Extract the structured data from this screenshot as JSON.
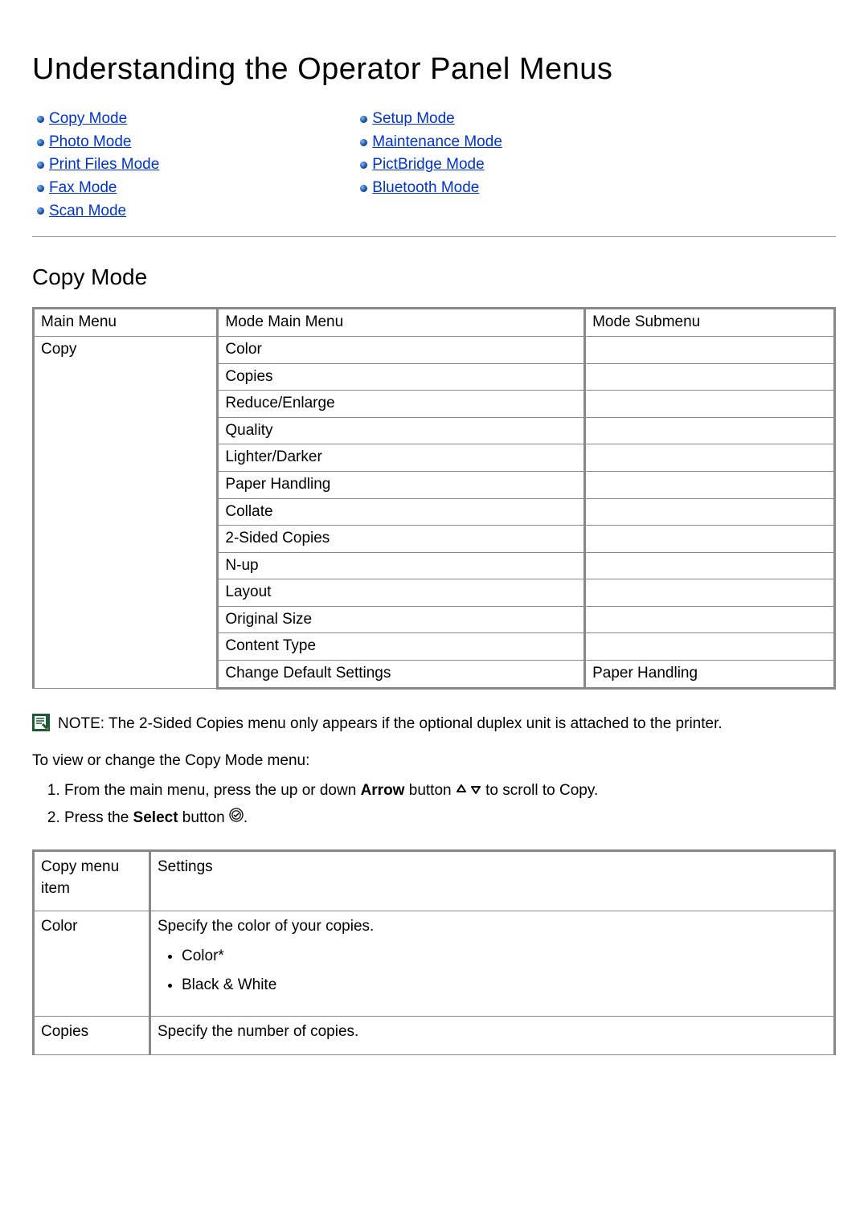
{
  "page_title": "Understanding the Operator Panel Menus",
  "toc": {
    "left": [
      {
        "label": "Copy Mode"
      },
      {
        "label": "Photo Mode"
      },
      {
        "label": "Print Files Mode"
      },
      {
        "label": "Fax Mode"
      },
      {
        "label": "Scan Mode"
      }
    ],
    "right": [
      {
        "label": "Setup Mode"
      },
      {
        "label": "Maintenance Mode"
      },
      {
        "label": "PictBridge Mode"
      },
      {
        "label": "Bluetooth Mode"
      }
    ]
  },
  "section_heading": "Copy Mode",
  "menu_table": {
    "headers": [
      "Main Menu",
      "Mode Main Menu",
      "Mode Submenu"
    ],
    "main_menu": "Copy",
    "rows": [
      {
        "mode_main_menu": "Color",
        "mode_submenu": ""
      },
      {
        "mode_main_menu": "Copies",
        "mode_submenu": ""
      },
      {
        "mode_main_menu": "Reduce/Enlarge",
        "mode_submenu": ""
      },
      {
        "mode_main_menu": "Quality",
        "mode_submenu": ""
      },
      {
        "mode_main_menu": "Lighter/Darker",
        "mode_submenu": ""
      },
      {
        "mode_main_menu": "Paper Handling",
        "mode_submenu": ""
      },
      {
        "mode_main_menu": "Collate",
        "mode_submenu": ""
      },
      {
        "mode_main_menu": "2-Sided Copies",
        "mode_submenu": ""
      },
      {
        "mode_main_menu": "N-up",
        "mode_submenu": ""
      },
      {
        "mode_main_menu": "Layout",
        "mode_submenu": ""
      },
      {
        "mode_main_menu": "Original Size",
        "mode_submenu": ""
      },
      {
        "mode_main_menu": "Content Type",
        "mode_submenu": ""
      },
      {
        "mode_main_menu": "Change Default Settings",
        "mode_submenu": "Paper Handling"
      }
    ]
  },
  "note": {
    "label": "NOTE:",
    "text": "The 2-Sided Copies menu only appears if the optional duplex unit is attached to the printer."
  },
  "instruction_intro": "To view or change the Copy Mode menu:",
  "steps": [
    {
      "prefix": "From the main menu, press the up or down ",
      "bold": "Arrow",
      "mid": " button ",
      "icon": "arrows",
      "suffix": " to scroll to Copy."
    },
    {
      "prefix": "Press the ",
      "bold": "Select",
      "mid": " button ",
      "icon": "select",
      "suffix": "."
    }
  ],
  "settings_table": {
    "headers": [
      "Copy menu item",
      "Settings"
    ],
    "rows": [
      {
        "item": "Color",
        "desc": "Specify the color of your copies.",
        "options": [
          "Color*",
          "Black & White"
        ]
      },
      {
        "item": "Copies",
        "desc": "Specify the number of copies.",
        "options": []
      }
    ]
  }
}
